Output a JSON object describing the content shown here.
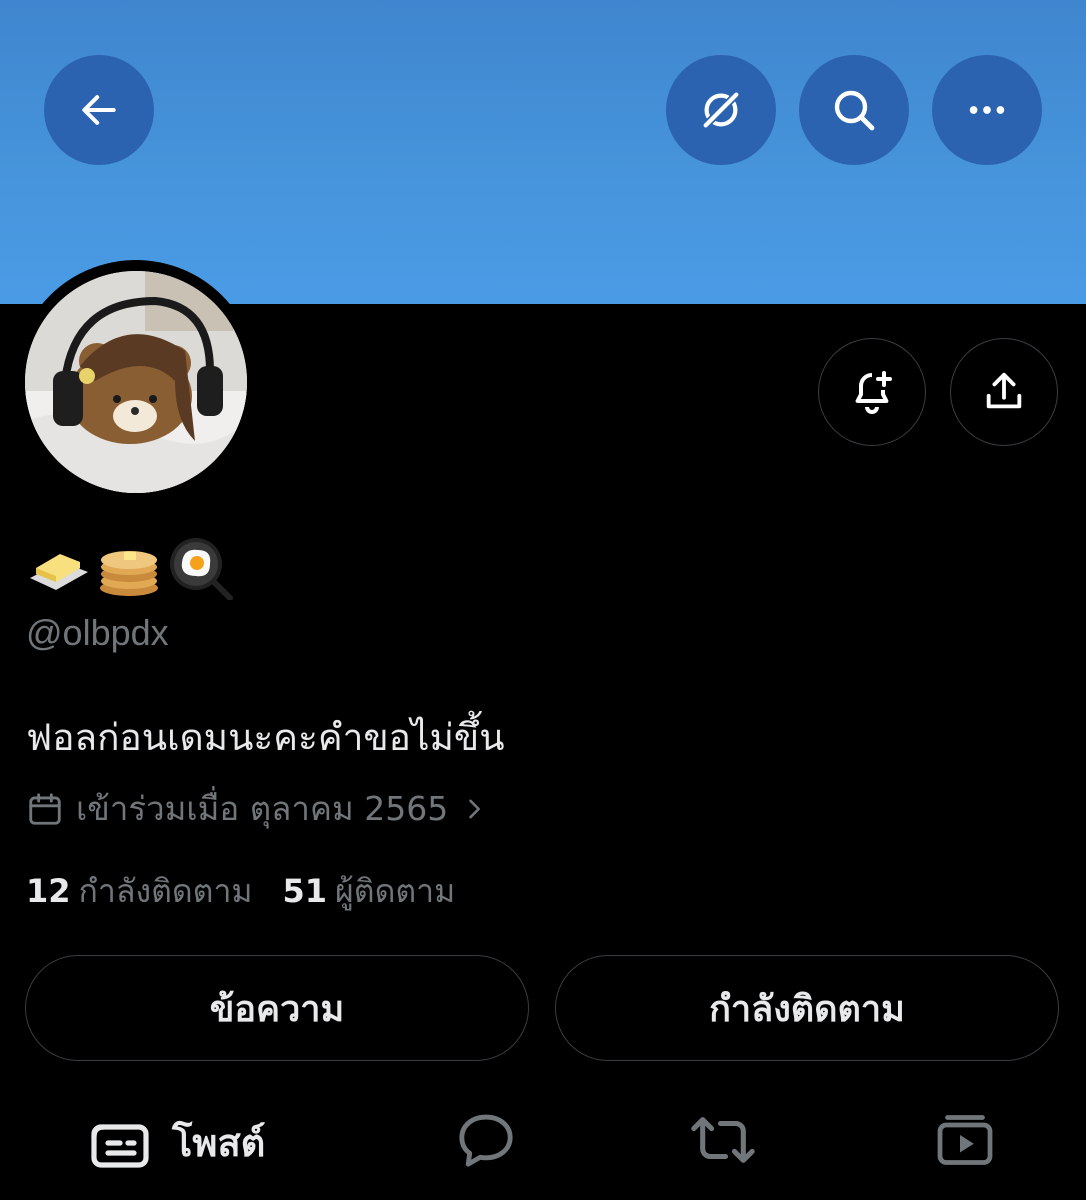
{
  "header": {
    "back_icon": "arrow-left-icon",
    "grok_icon": "grok-icon",
    "search_icon": "search-icon",
    "more_icon": "more-horizontal-icon",
    "banner_color": "#4795dc",
    "button_color": "#2b63b1"
  },
  "profile": {
    "display_name_emojis": [
      "butter",
      "pancakes",
      "fried-egg-pan"
    ],
    "handle": "@olbpdx",
    "bio": "ฟอลก่อนเดมนะคะคำขอไม่ขึ้น",
    "joined": "เข้าร่วมเมื่อ ตุลาคม 2565",
    "following_count": "12",
    "following_label": "กำลังติดตาม",
    "followers_count": "51",
    "followers_label": "ผู้ติดตาม"
  },
  "actions": {
    "notify_icon": "bell-plus-icon",
    "share_icon": "share-upload-icon",
    "message_label": "ข้อความ",
    "following_label": "กำลังติดตาม"
  },
  "tabs": {
    "posts_label": "โพสต์",
    "replies_icon": "reply-bubble-icon",
    "reposts_icon": "repost-icon",
    "media_icon": "media-play-icon"
  }
}
